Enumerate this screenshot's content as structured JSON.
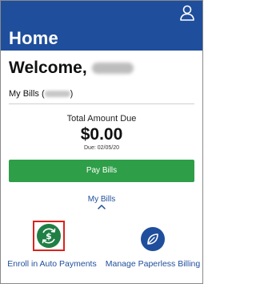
{
  "header": {
    "title": "Home",
    "profile_icon": "person-icon",
    "bg_color": "#1f4e9c"
  },
  "welcome": {
    "greeting": "Welcome,",
    "name_redacted": "Samuel"
  },
  "bills": {
    "label_prefix": "My Bills (",
    "label_suffix": ")",
    "account_redacted": "123456"
  },
  "amount": {
    "label": "Total Amount Due",
    "value": "$0.00",
    "due_date": "Due: 02/05/20"
  },
  "pay_button": {
    "label": "Pay Bills",
    "color": "#2f9e48"
  },
  "my_bills_link": {
    "label": "My Bills",
    "icon": "chevron-up-icon"
  },
  "actions": [
    {
      "label": "Enroll in Auto Payments",
      "icon": "autopay-dollar-icon",
      "color": "#1f7f45",
      "highlighted": true
    },
    {
      "label": "Manage Paperless Billing",
      "icon": "leaf-icon",
      "color": "#1f4e9c",
      "highlighted": false
    }
  ],
  "colors": {
    "accent": "#1f4e9c",
    "highlight": "#d9231e"
  }
}
